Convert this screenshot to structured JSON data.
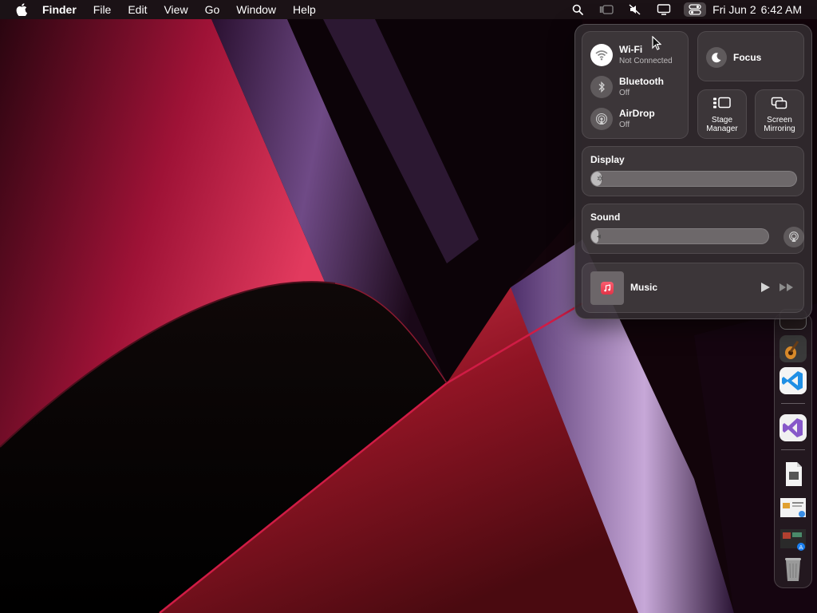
{
  "menubar": {
    "app_name": "Finder",
    "items": [
      "File",
      "Edit",
      "View",
      "Go",
      "Window",
      "Help"
    ],
    "date": "Fri Jun 2",
    "time": "6:42 AM",
    "status_icons": [
      "search-icon",
      "stage-manager-icon",
      "mute-icon",
      "display-icon",
      "control-center-icon"
    ]
  },
  "control_center": {
    "wifi": {
      "label": "Wi-Fi",
      "status": "Not Connected"
    },
    "bluetooth": {
      "label": "Bluetooth",
      "status": "Off"
    },
    "airdrop": {
      "label": "AirDrop",
      "status": "Off"
    },
    "focus": {
      "label": "Focus"
    },
    "stage_manager": {
      "line1": "Stage",
      "line2": "Manager"
    },
    "screen_mirroring": {
      "line1": "Screen",
      "line2": "Mirroring"
    },
    "display": {
      "label": "Display",
      "level": 0.05
    },
    "sound": {
      "label": "Sound",
      "level": 0.04
    },
    "music": {
      "label": "Music"
    }
  },
  "dock": {
    "apps": [
      "blank-app-icon",
      "garageband-icon",
      "vscode-icon",
      "visual-studio-icon",
      "document-icon",
      "preview-image-icon",
      "app-store-icon",
      "trash-icon"
    ]
  },
  "colors": {
    "accent_red": "#c0163a",
    "wallpaper_dark": "#0a0205",
    "wallpaper_violet": "#b79ac8",
    "vscode_blue": "#1f8fe5",
    "visual_studio_purple": "#8758c9"
  }
}
